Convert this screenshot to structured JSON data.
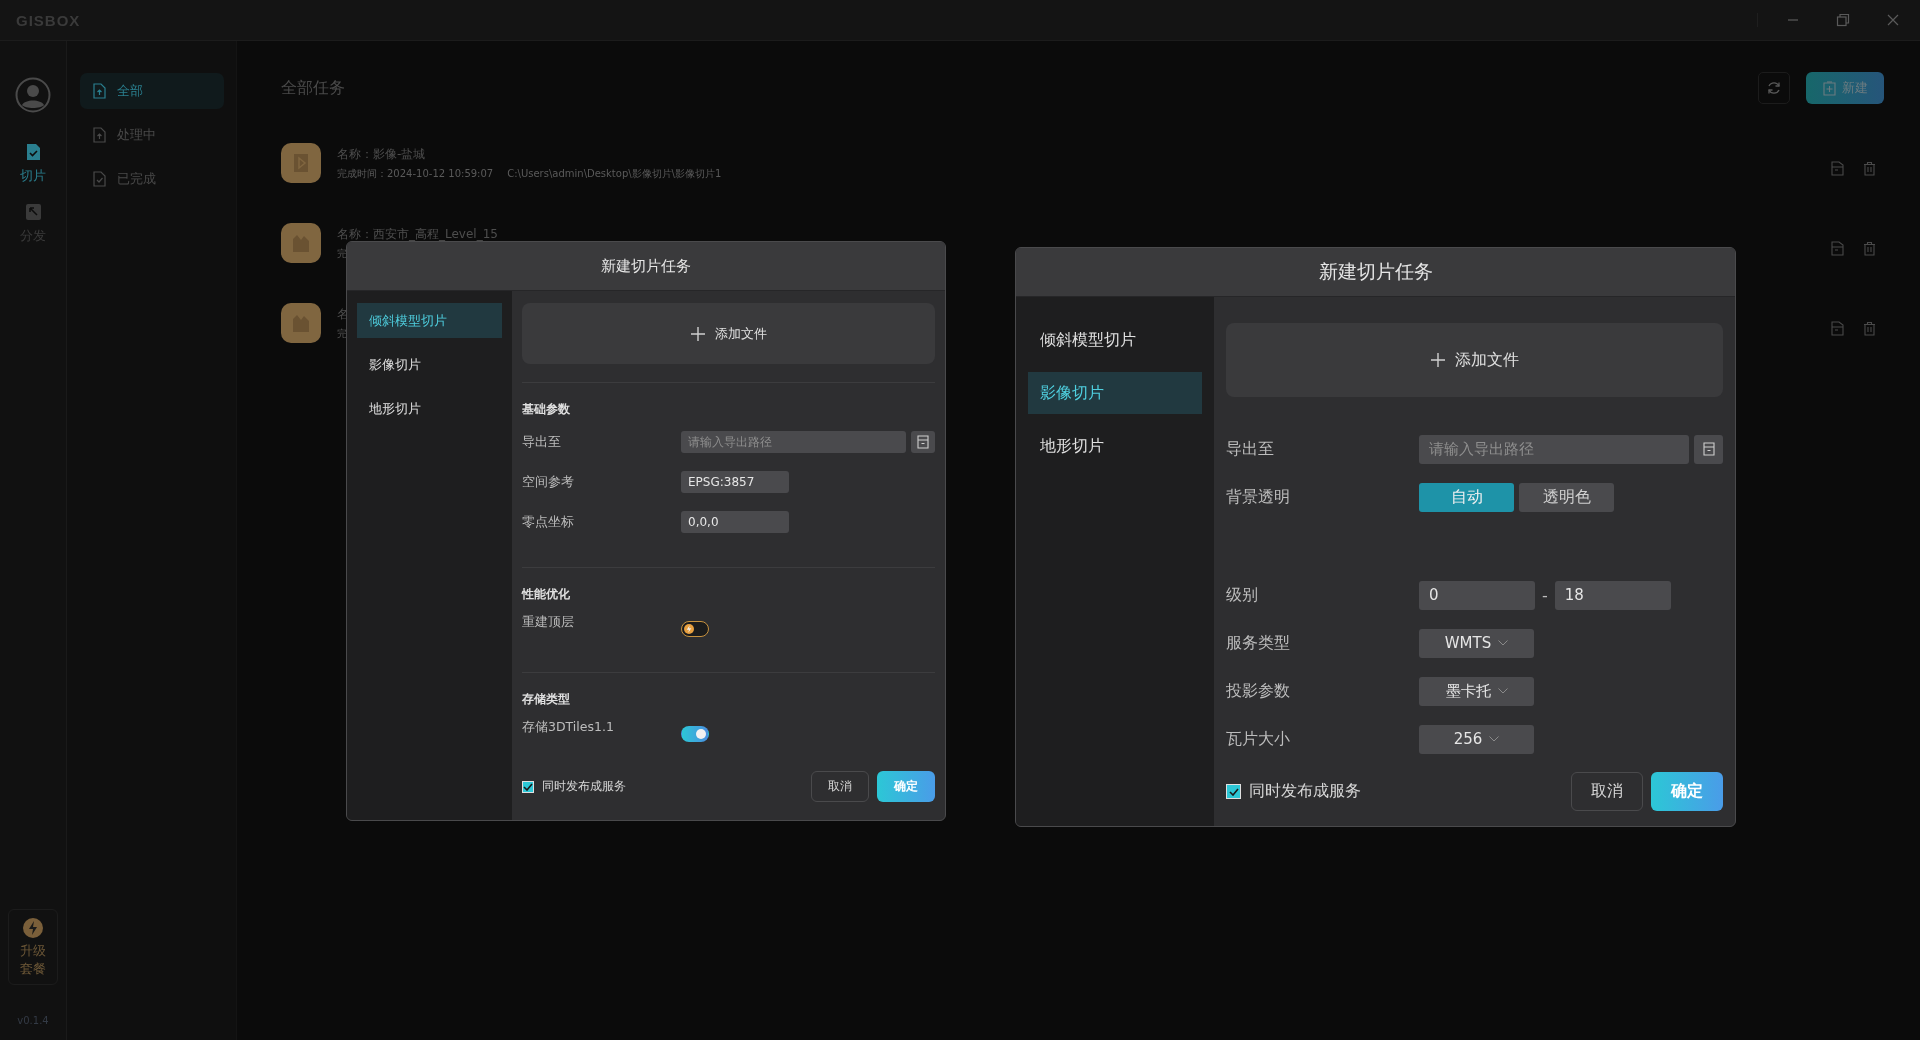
{
  "app": {
    "logo": "GISBOX"
  },
  "rail": {
    "items": [
      {
        "label": "切片",
        "selected": true
      },
      {
        "label": "分发",
        "selected": false
      }
    ],
    "upgrade": "升级套餐",
    "version": "v0.1.4"
  },
  "sidebar": {
    "items": [
      {
        "label": "全部",
        "selected": true
      },
      {
        "label": "处理中",
        "selected": false
      },
      {
        "label": "已完成",
        "selected": false
      }
    ]
  },
  "main": {
    "title": "全部任务",
    "new_button": "新建",
    "tasks": [
      {
        "kind": "image",
        "name": "名称：影像-盐城",
        "time": "完成时间：2024-10-12 10:59:07",
        "path": "C:\\Users\\admin\\Desktop\\影像切片\\影像切片1"
      },
      {
        "kind": "terrain",
        "name": "名称：西安市_高程_Level_15",
        "time": "完"
      },
      {
        "kind": "terrain",
        "name": "名",
        "time": "完"
      }
    ]
  },
  "dialogs": [
    {
      "title": "新建切片任务",
      "nav": [
        {
          "label": "倾斜模型切片",
          "selected": true
        },
        {
          "label": "影像切片",
          "selected": false
        },
        {
          "label": "地形切片",
          "selected": false
        }
      ],
      "add_file": "添加文件",
      "sections": [
        {
          "title": "基础参数",
          "rows": [
            {
              "kind": "path",
              "label": "导出至",
              "placeholder": "请输入导出路径"
            },
            {
              "kind": "text",
              "label": "空间参考",
              "value": "EPSG:3857"
            },
            {
              "kind": "text",
              "label": "零点坐标",
              "value": "0,0,0"
            }
          ]
        },
        {
          "title": "性能优化",
          "rows": [
            {
              "kind": "toggle",
              "label": "重建顶层",
              "on": false
            }
          ]
        },
        {
          "title": "存储类型",
          "rows": [
            {
              "kind": "toggle",
              "label": "存储3DTiles1.1",
              "on": true
            }
          ]
        }
      ],
      "publish": {
        "label": "同时发布成服务",
        "checked": true
      },
      "cancel": "取消",
      "confirm": "确定"
    },
    {
      "title": "新建切片任务",
      "nav": [
        {
          "label": "倾斜模型切片",
          "selected": false
        },
        {
          "label": "影像切片",
          "selected": true
        },
        {
          "label": "地形切片",
          "selected": false
        }
      ],
      "add_file": "添加文件",
      "sections": [
        {
          "rows": [
            {
              "kind": "path",
              "label": "导出至",
              "placeholder": "请输入导出路径"
            },
            {
              "kind": "segmented",
              "label": "背景透明",
              "options": [
                {
                  "label": "自动",
                  "selected": true
                },
                {
                  "label": "透明色",
                  "selected": false
                }
              ]
            },
            {
              "kind": "range",
              "label": "级别",
              "from": "0",
              "separator": "-",
              "to": "18"
            },
            {
              "kind": "select",
              "label": "服务类型",
              "value": "WMTS"
            },
            {
              "kind": "select",
              "label": "投影参数",
              "value": "墨卡托"
            },
            {
              "kind": "select",
              "label": "瓦片大小",
              "value": "256"
            }
          ]
        }
      ],
      "publish": {
        "label": "同时发布成服务",
        "checked": true
      },
      "cancel": "取消",
      "confirm": "确定"
    }
  ]
}
